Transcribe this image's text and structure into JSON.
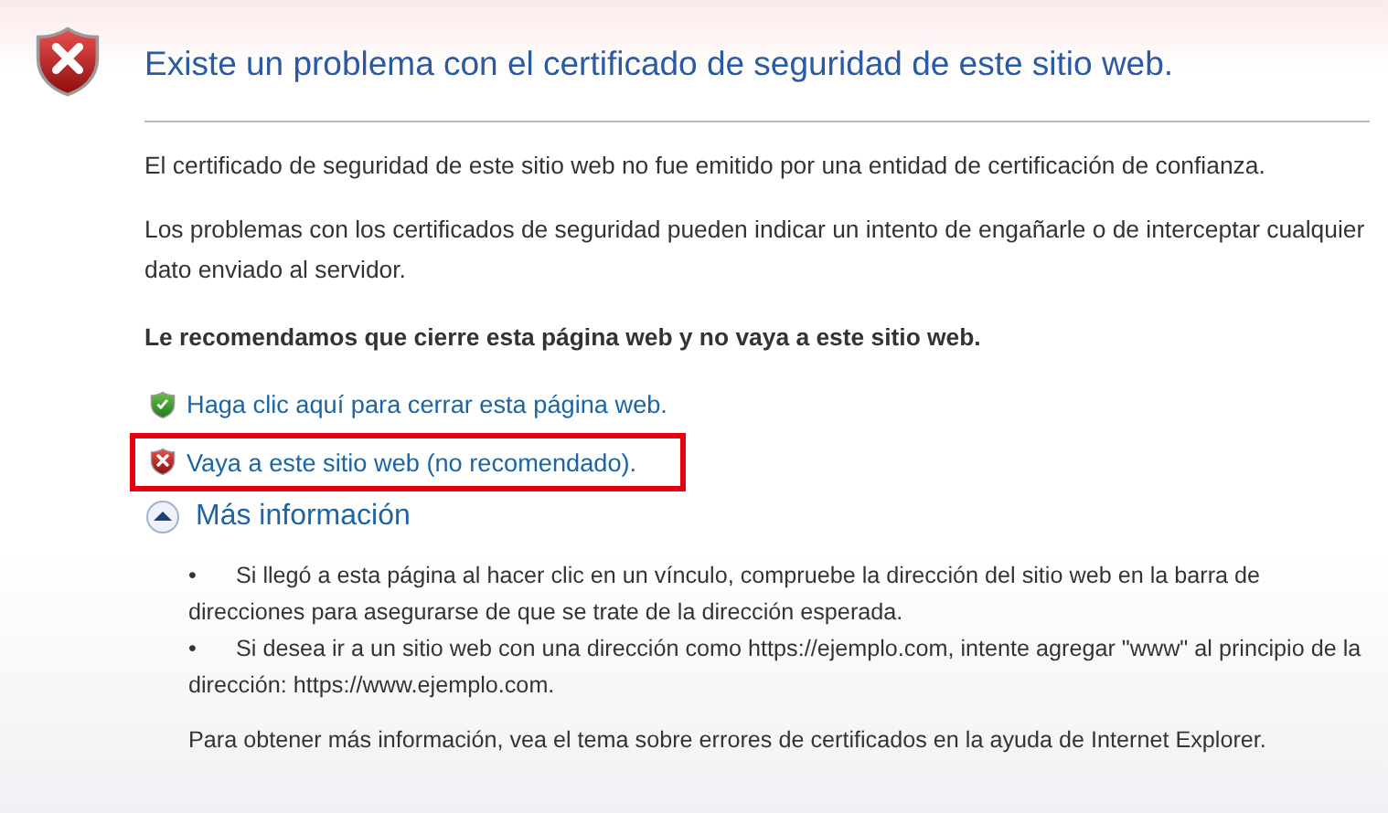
{
  "header": {
    "title": "Existe un problema con el certificado de seguridad de este sitio web."
  },
  "paragraphs": [
    {
      "kind": "plain",
      "text": "El certificado de seguridad de este sitio web no fue emitido por una entidad de certificación de confianza."
    },
    {
      "kind": "plain",
      "text": "Los problemas con los certificados de seguridad pueden indicar un intento de engañarle o de interceptar cualquier dato enviado al servidor."
    },
    {
      "kind": "bold",
      "text": "Le recomendamos que cierre esta página web y no vaya a este sitio web."
    }
  ],
  "links": [
    {
      "kind": "safe",
      "text": "Haga clic aquí para cerrar esta página web.",
      "highlighted": false
    },
    {
      "kind": "unsafe",
      "text": "Vaya a este sitio web (no recomendado).",
      "highlighted": true
    }
  ],
  "more_info": {
    "label": "Más información",
    "expanded": true,
    "bullets": [
      {
        "bullet": "•",
        "text": "Si llegó a esta página al hacer clic en un vínculo, compruebe la dirección del sitio web en la barra de direcciones para asegurarse de que se trate de la dirección esperada."
      },
      {
        "bullet": "•",
        "text": "Si desea ir a un sitio web con una dirección como https://ejemplo.com, intente agregar \"www\" al principio de la dirección: https://www.ejemplo.com."
      }
    ],
    "note": "Para obtener más información, vea el tema sobre errores de certificados en la ayuda de Internet Explorer."
  }
}
